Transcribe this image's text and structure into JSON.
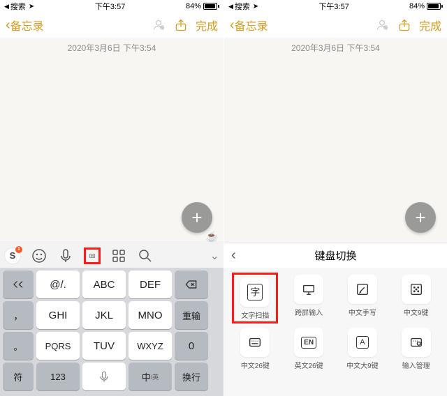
{
  "statusbar": {
    "back_app": "搜索",
    "time": "下午3:57",
    "battery_pct": "84%"
  },
  "nav": {
    "back_label": "备忘录",
    "done_label": "完成"
  },
  "note": {
    "timestamp": "2020年3月6日 下午3:54"
  },
  "keypad": {
    "rows": [
      [
        "",
        "@/.",
        "ABC",
        "DEF",
        "⌫"
      ],
      [
        "，",
        "GHI",
        "JKL",
        "MNO",
        "重输"
      ],
      [
        "。",
        "PQRS",
        "TUV",
        "WXYZ",
        "0"
      ],
      [
        "符",
        "123",
        "space",
        "中/英",
        "换行"
      ]
    ],
    "zh_en_main": "中",
    "zh_en_sub": "/英"
  },
  "switch_panel": {
    "title": "键盘切换",
    "items": [
      {
        "icon": "字",
        "label": "文字扫描"
      },
      {
        "icon": "screen",
        "label": "跨屏输入"
      },
      {
        "icon": "pen",
        "label": "中文手写"
      },
      {
        "icon": "grid9",
        "label": "中文9键"
      },
      {
        "icon": "grid26",
        "label": "中文26键"
      },
      {
        "icon": "EN",
        "label": "英文26键"
      },
      {
        "icon": "A",
        "label": "中文大9键"
      },
      {
        "icon": "gear",
        "label": "输入管理"
      }
    ]
  }
}
